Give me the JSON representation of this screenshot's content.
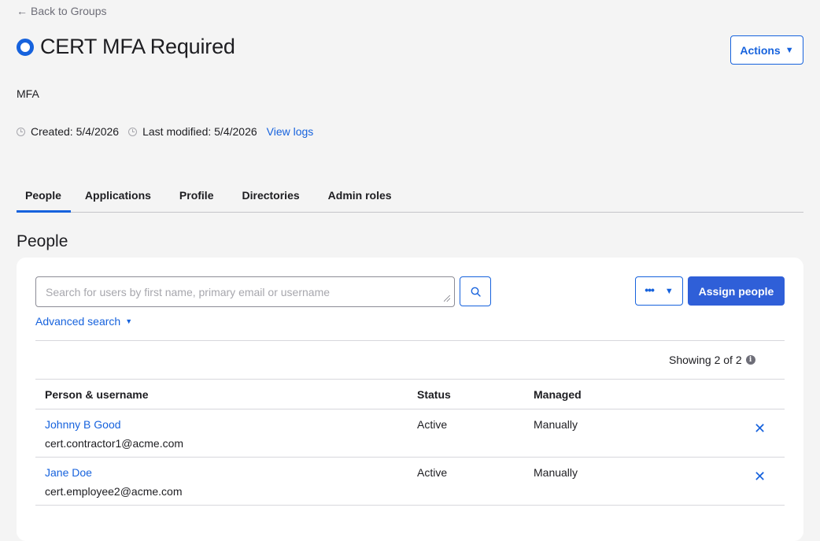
{
  "back_link": {
    "label": "Back to Groups",
    "icon": "arrow-left-icon"
  },
  "header": {
    "title": "CERT MFA Required",
    "icon": "group-icon",
    "actions_label": "Actions"
  },
  "description": "MFA",
  "meta": {
    "created": "Created: 5/4/2026",
    "modified": "Last modified: 5/4/2026",
    "view_logs": "View logs"
  },
  "tabs": [
    {
      "label": "People",
      "active": true
    },
    {
      "label": "Applications",
      "active": false
    },
    {
      "label": "Profile",
      "active": false
    },
    {
      "label": "Directories",
      "active": false
    },
    {
      "label": "Admin roles",
      "active": false
    }
  ],
  "section_title": "People",
  "toolbar": {
    "search_placeholder": "Search for users by first name, primary email or username",
    "advanced_search": "Advanced search",
    "assign_label": "Assign people"
  },
  "showing": "Showing 2 of 2",
  "table": {
    "headers": [
      "Person & username",
      "Status",
      "Managed"
    ],
    "rows": [
      {
        "name": "Johnny B Good",
        "username": "cert.contractor1@acme.com",
        "status": "Active",
        "managed": "Manually"
      },
      {
        "name": "Jane Doe",
        "username": "cert.employee2@acme.com",
        "status": "Active",
        "managed": "Manually"
      }
    ]
  },
  "colors": {
    "accent": "#1662dd",
    "primary_button": "#2f5fd8",
    "background": "#f4f4f4"
  }
}
